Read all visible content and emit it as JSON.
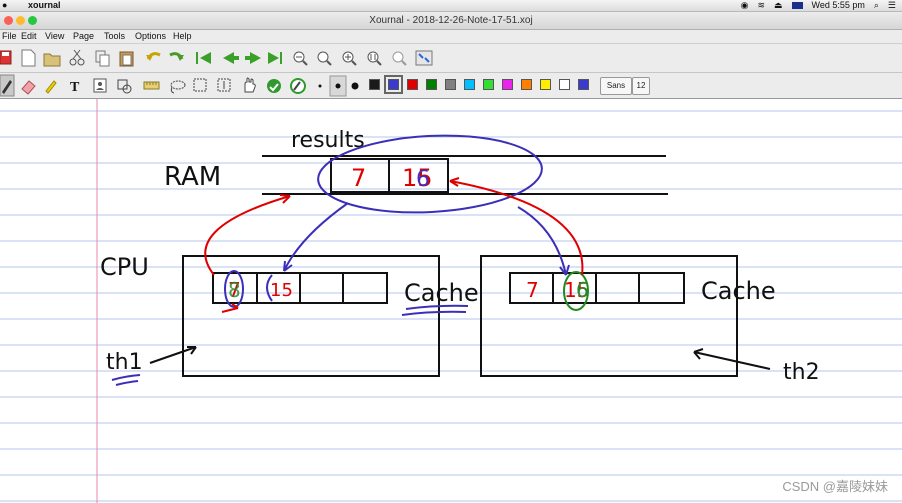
{
  "system_menubar": {
    "apple_icon": "apple-icon",
    "app_name": "xournal",
    "clock": "Wed 5:55 pm"
  },
  "window": {
    "title": "Xournal - 2018-12-26-Note-17-51.xoj"
  },
  "menu": {
    "file": "File",
    "edit": "Edit",
    "view": "View",
    "page": "Page",
    "tools": "Tools",
    "options": "Options",
    "help": "Help"
  },
  "toolbar2": {
    "font_name": "Sans",
    "font_size": "12",
    "colors": [
      "#1a1a1a",
      "#3a3acc",
      "#e00000",
      "#008000",
      "#808080",
      "#00bfff",
      "#33dd33",
      "#ee22ee",
      "#ff8000",
      "#ffee00",
      "#ffffff",
      "#3a3acc"
    ]
  },
  "note": {
    "results": "results",
    "ram": "RAM",
    "ram_cell_1": "7",
    "ram_cell_2": "15",
    "ram_cell_2_overwrite": "6",
    "cpu": "CPU",
    "cache_left": "Cache",
    "cache_right": "Cache",
    "left_cell_1": "7",
    "left_cell_1_overwrite": "8",
    "left_cell_2": "15",
    "right_cell_1": "7",
    "right_cell_2": "15",
    "right_cell_2_overwrite": "6",
    "th1": "th1",
    "th2": "th2"
  },
  "watermark": "CSDN @嘉陵妹妹"
}
